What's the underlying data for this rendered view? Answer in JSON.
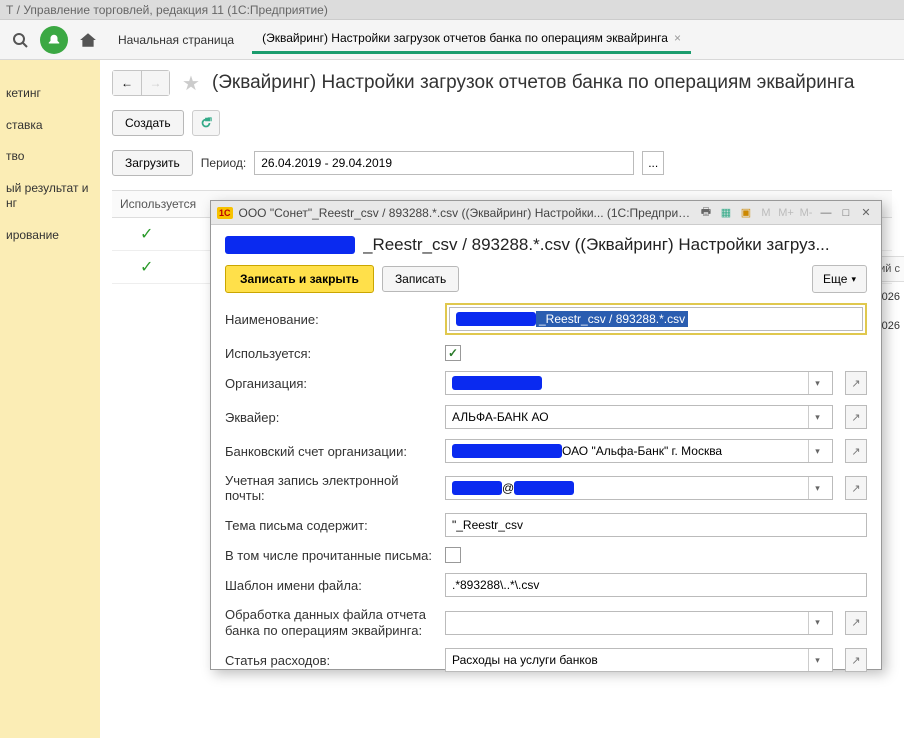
{
  "app": {
    "title": "Т / Управление торговлей, редакция 11   (1С:Предприятие)"
  },
  "toolbar": {
    "home_label": "Начальная страница",
    "tab_label": "(Эквайринг) Настройки загрузок отчетов банка по операциям эквайринга"
  },
  "sidebar": {
    "items": [
      {
        "label": "кетинг"
      },
      {
        "label": "ставка"
      },
      {
        "label": "тво"
      },
      {
        "label": "ый результат и нг"
      },
      {
        "label": "ирование"
      }
    ]
  },
  "page": {
    "title": "(Эквайринг) Настройки загрузок отчетов банка по операциям эквайринга",
    "create": "Создать",
    "load": "Загрузить",
    "period_label": "Период:",
    "period_value": "26.04.2019 - 29.04.2019",
    "grid": {
      "col_used": "Используется",
      "right_header": "кий с",
      "right_rows": [
        "09026",
        "09026"
      ]
    }
  },
  "dialog": {
    "window_title": "ООО \"Сонет\"_Reestr_csv / 893288.*.csv ((Эквайринг) Настройки...   (1С:Предприятие)",
    "title_visible": "_Reestr_csv / 893288.*.csv ((Эквайринг) Настройки загруз...",
    "btn_save_close": "Записать и закрыть",
    "btn_save": "Записать",
    "btn_more": "Еще",
    "title_icons": {
      "m": "M",
      "mplus": "M+",
      "mminus": "M-"
    },
    "fields": {
      "name": {
        "label": "Наименование:",
        "value": "_Reestr_csv / 893288.*.csv"
      },
      "used": {
        "label": "Используется:",
        "checked": true
      },
      "org": {
        "label": "Организация:",
        "value": ""
      },
      "acquirer": {
        "label": "Эквайер:",
        "value": "АЛЬФА-БАНК АО"
      },
      "bank_acc": {
        "label": "Банковский счет организации:",
        "suffix": " ОАО \"Альфа-Банк\" г. Москва"
      },
      "email": {
        "label": "Учетная запись электронной почты:",
        "mid": "@"
      },
      "subject": {
        "label": "Тема письма содержит:",
        "value": "\"_Reestr_csv"
      },
      "include_read": {
        "label": "В том числе прочитанные письма:",
        "checked": false
      },
      "filename": {
        "label": "Шаблон имени файла:",
        "value": ".*893288\\..*\\.csv"
      },
      "proc": {
        "label": "Обработка данных файла отчета банка по операциям эквайринга:",
        "value": ""
      },
      "expense": {
        "label": "Статья расходов:",
        "value": "Расходы на услуги банков"
      }
    }
  }
}
